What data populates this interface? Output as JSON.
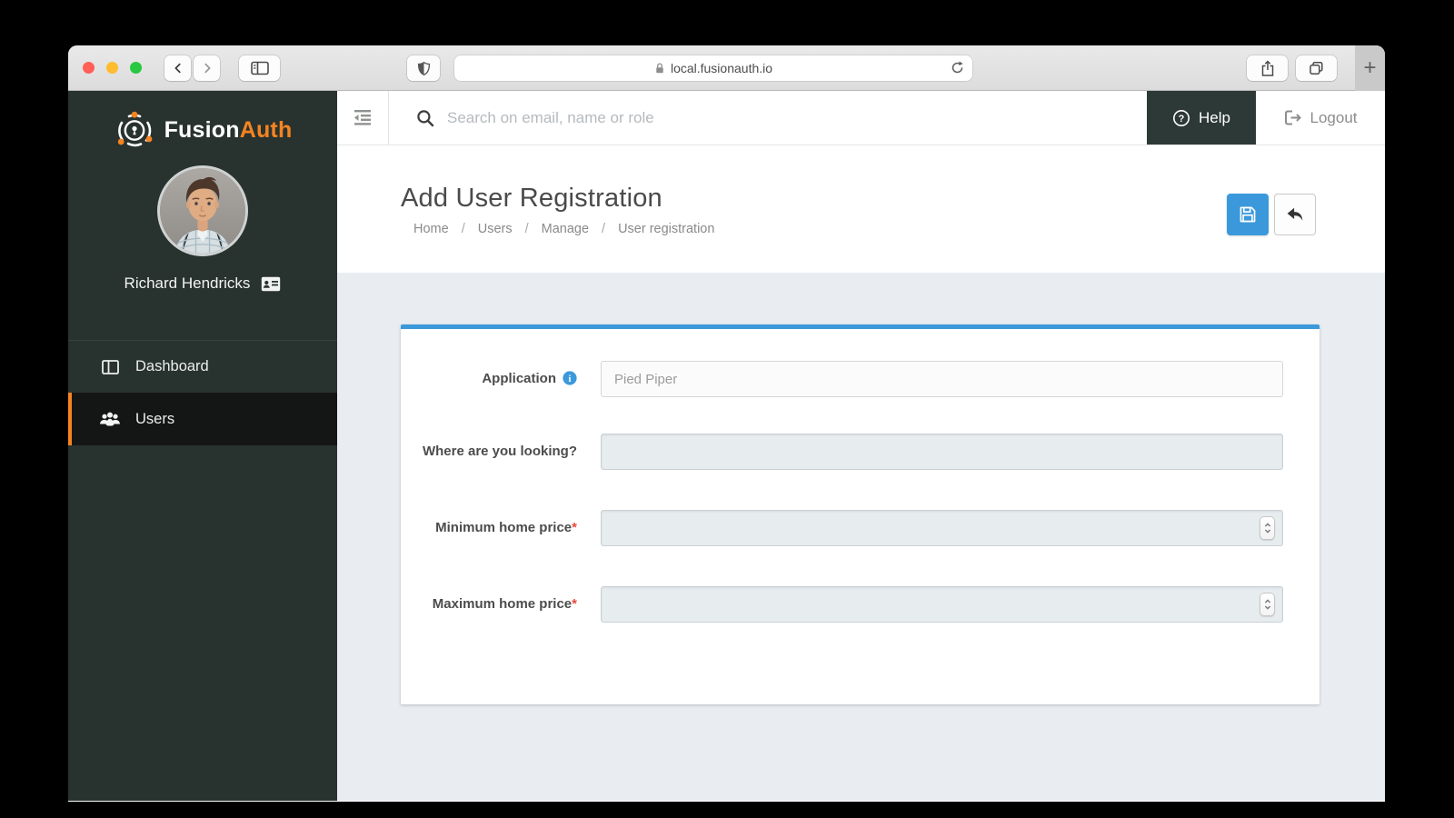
{
  "browser": {
    "url": "local.fusionauth.io",
    "new_tab_label": "+"
  },
  "sidebar": {
    "brand": {
      "fusion": "Fusion",
      "auth": "Auth"
    },
    "user_name": "Richard Hendricks",
    "nav": [
      {
        "label": "Dashboard",
        "active": false
      },
      {
        "label": "Users",
        "active": true
      }
    ]
  },
  "topbar": {
    "search_placeholder": "Search on email, name or role",
    "help_label": "Help",
    "logout_label": "Logout"
  },
  "page": {
    "title": "Add User Registration",
    "breadcrumb": [
      "Home",
      "Users",
      "Manage",
      "User registration"
    ]
  },
  "form": {
    "required_marker": "*",
    "fields": [
      {
        "label": "Application",
        "placeholder": "Pied Piper",
        "info": true,
        "required": false,
        "type": "text"
      },
      {
        "label": "Where are you looking?",
        "placeholder": "",
        "required": false,
        "type": "text"
      },
      {
        "label": "Minimum home price",
        "placeholder": "",
        "required": true,
        "type": "number"
      },
      {
        "label": "Maximum home price",
        "placeholder": "",
        "required": true,
        "type": "number"
      }
    ]
  },
  "colors": {
    "sidebar_bg": "#28322f",
    "sidebar_active_bg": "#141615",
    "brand_orange": "#f58420",
    "accent_blue": "#3b99db",
    "help_bg": "#2d3936",
    "content_bg": "#e9edf1",
    "required_red": "#e8483b",
    "input_fill": "#e7ecef",
    "input_border": "#c9d1d7",
    "traffic_red": "#ff5f57",
    "traffic_yellow": "#febc2e",
    "traffic_green": "#28c840"
  }
}
